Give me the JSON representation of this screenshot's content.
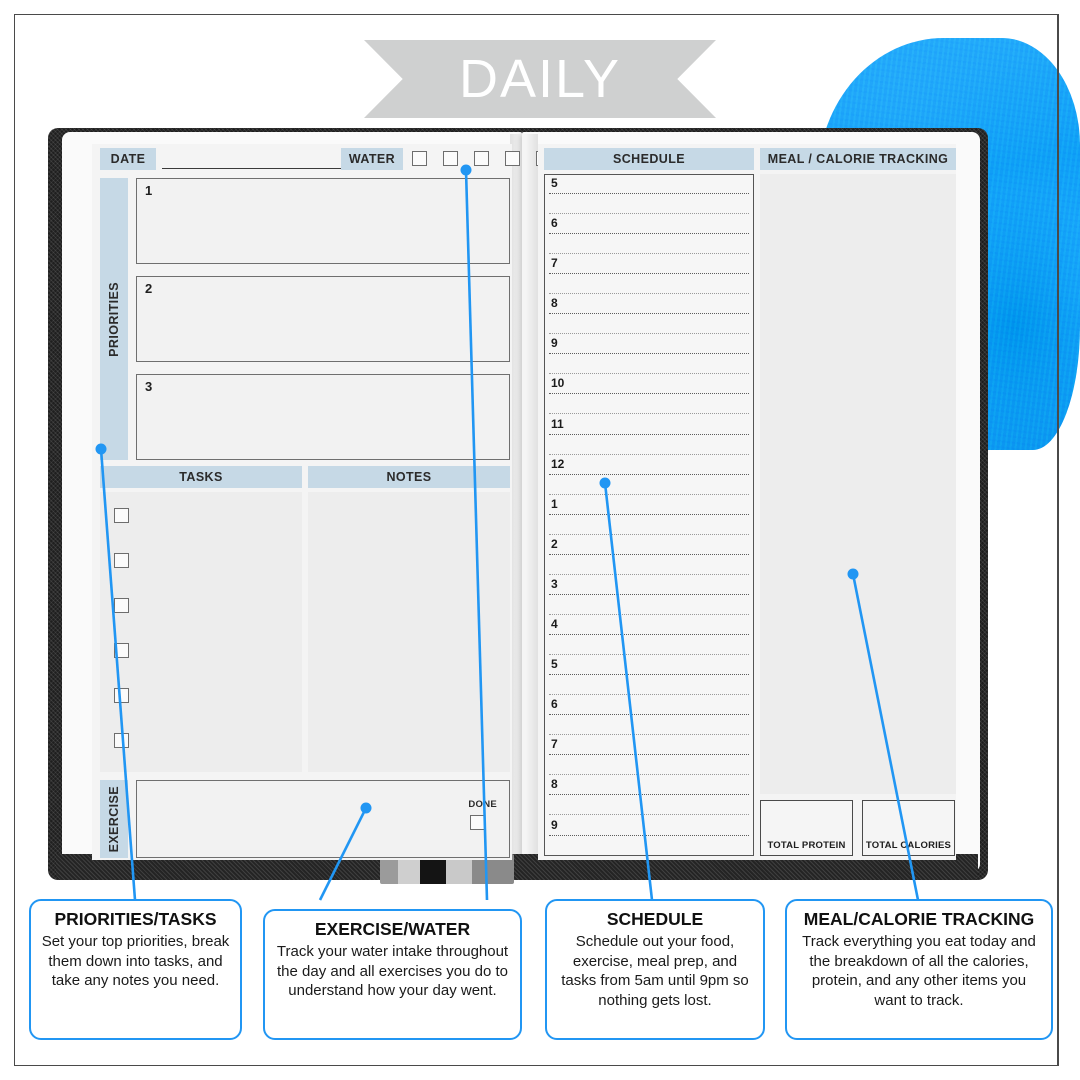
{
  "banner": {
    "title": "DAILY"
  },
  "planner": {
    "left_page": {
      "date_label": "DATE",
      "water_label": "WATER",
      "water_checkbox_count": 5,
      "priorities_label": "PRIORITIES",
      "priority_numbers": [
        "1",
        "2",
        "3"
      ],
      "tasks_header": "TASKS",
      "notes_header": "NOTES",
      "task_checkbox_count": 6,
      "exercise_label": "EXERCISE",
      "done_label": "DONE"
    },
    "right_page": {
      "schedule_header": "SCHEDULE",
      "meal_header": "MEAL / CALORIE TRACKING",
      "schedule_hours": [
        "5",
        "6",
        "7",
        "8",
        "9",
        "10",
        "11",
        "12",
        "1",
        "2",
        "3",
        "4",
        "5",
        "6",
        "7",
        "8",
        "9"
      ],
      "total_protein_label": "TOTAL PROTEIN",
      "total_calories_label": "TOTAL CALORIES"
    }
  },
  "callouts": [
    {
      "title": "PRIORITIES/TASKS",
      "body": "Set your top priorities, break them down into tasks, and take any notes you need."
    },
    {
      "title": "EXERCISE/WATER",
      "body": "Track your water intake throughout the day and all exercises you do to understand how your day went."
    },
    {
      "title": "SCHEDULE",
      "body": "Schedule out your food, exercise, meal prep, and tasks from 5am until 9pm so nothing gets lost."
    },
    {
      "title": "MEAL/CALORIE TRACKING",
      "body": "Track everything you eat today and the breakdown of all the calories, protein, and any other items you want to track."
    }
  ],
  "colors": {
    "accent": "#2196f3",
    "header_fill": "#c6d9e6",
    "banner_fill": "#cfd0d0",
    "splash": "#1f9bea"
  }
}
